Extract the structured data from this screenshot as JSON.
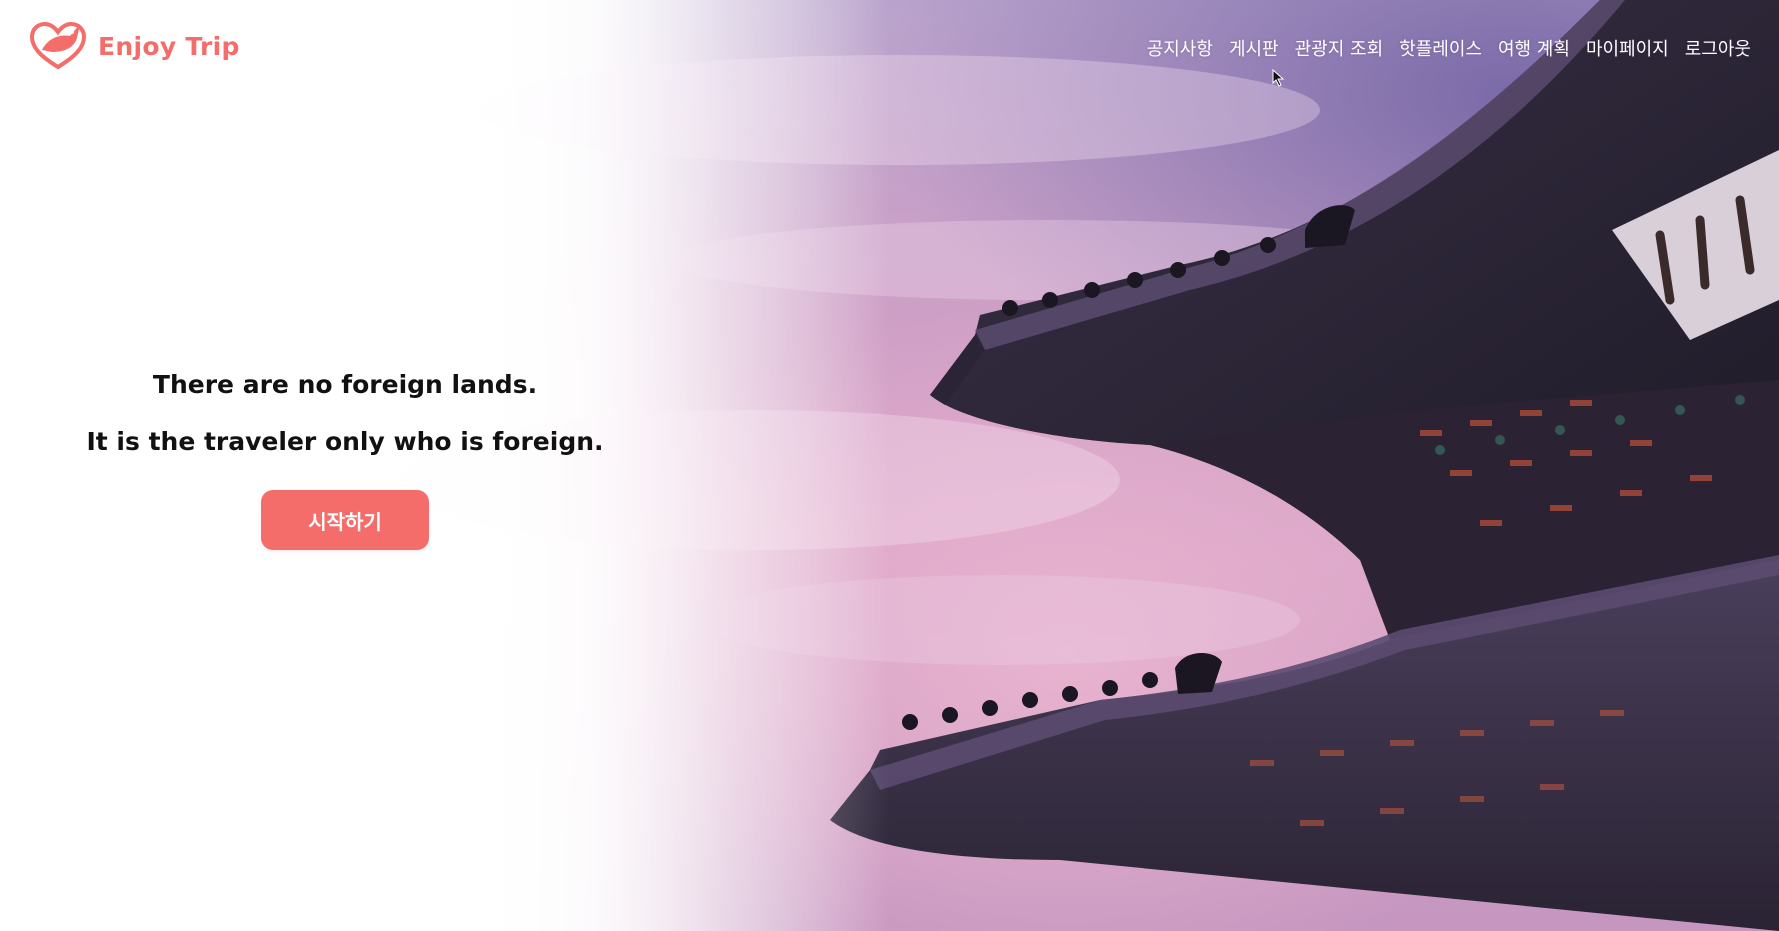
{
  "brand": {
    "name": "Enjoy Trip",
    "logo_icon": "heart-bird-logo",
    "color": "#f46d6a"
  },
  "nav": {
    "items": [
      {
        "label": "공지사항"
      },
      {
        "label": "게시판"
      },
      {
        "label": "관광지 조회"
      },
      {
        "label": "핫플레이스"
      },
      {
        "label": "여행 계획"
      },
      {
        "label": "마이페이지"
      },
      {
        "label": "로그아웃"
      }
    ]
  },
  "hero": {
    "quote_line1": "There are no foreign lands.",
    "quote_line2": "It is the traveler only who is foreign.",
    "start_button_label": "시작하기",
    "background_image": "palace-roof-at-dusk"
  },
  "colors": {
    "accent": "#f46d6a",
    "nav_text": "#ffffff",
    "quote_text": "#111111"
  }
}
